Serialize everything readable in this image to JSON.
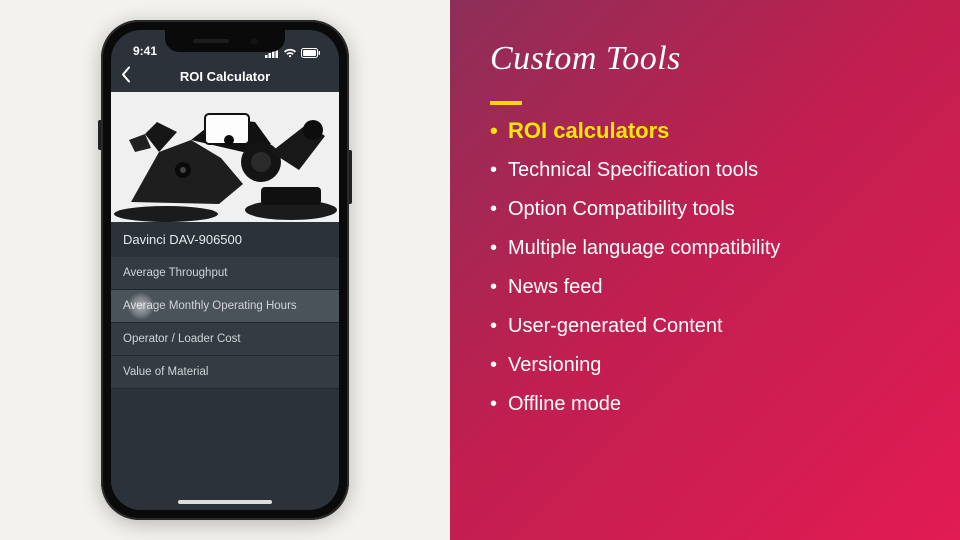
{
  "slide": {
    "title": "Custom Tools",
    "bullets": [
      {
        "text": "ROI calculators",
        "highlight": true
      },
      {
        "text": "Technical Specification tools",
        "highlight": false
      },
      {
        "text": "Option Compatibility tools",
        "highlight": false
      },
      {
        "text": "Multiple language compatibility",
        "highlight": false
      },
      {
        "text": "News feed",
        "highlight": false
      },
      {
        "text": "User-generated Content",
        "highlight": false
      },
      {
        "text": "Versioning",
        "highlight": false
      },
      {
        "text": "Offline mode",
        "highlight": false
      }
    ]
  },
  "phone": {
    "status": {
      "time": "9:41"
    },
    "header": {
      "title": "ROI Calculator"
    },
    "product": "Davinci DAV-906500",
    "rows": [
      {
        "label": "Average Throughput",
        "selected": false
      },
      {
        "label": "Average Monthly Operating Hours",
        "selected": true
      },
      {
        "label": "Operator / Loader Cost",
        "selected": false
      },
      {
        "label": "Value of Material",
        "selected": false
      }
    ]
  }
}
